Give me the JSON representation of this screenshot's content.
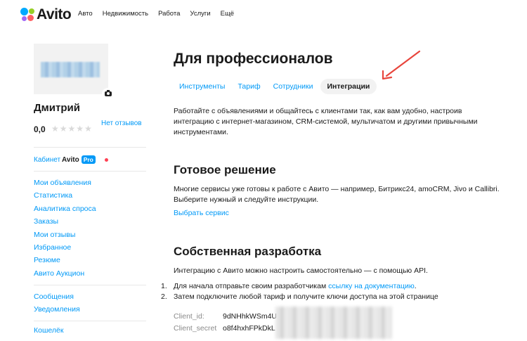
{
  "header": {
    "logo_text": "Avito",
    "nav": [
      "Авто",
      "Недвижимость",
      "Работа",
      "Услуги",
      "Ещё"
    ]
  },
  "sidebar": {
    "user_name": "Дмитрий",
    "rating": "0,0",
    "stars_total": 5,
    "stars_filled": 0,
    "reviews_link": "Нет отзывов",
    "cabinet_label": "Кабинет",
    "cabinet_brand": "Avito",
    "cabinet_badge": "Pro",
    "menu": [
      "Мои объявления",
      "Статистика",
      "Аналитика спроса",
      "Заказы",
      "Мои отзывы",
      "Избранное",
      "Резюме",
      "Авито Аукцион"
    ],
    "menu2": [
      "Сообщения",
      "Уведомления"
    ],
    "menu3": [
      "Кошелёк"
    ]
  },
  "main": {
    "title": "Для профессионалов",
    "tabs": [
      {
        "label": "Инструменты",
        "active": false
      },
      {
        "label": "Тариф",
        "active": false
      },
      {
        "label": "Сотрудники",
        "active": false
      },
      {
        "label": "Интеграции",
        "active": true
      }
    ],
    "intro": "Работайте с объявлениями и общайтесь с клиентами так, как вам удобно, настроив интеграцию с интернет-магазином, CRM-системой, мультичатом и другими привычными инструментами.",
    "ready_title": "Готовое решение",
    "ready_text": "Многие сервисы уже готовы к работе с Авито — например, Битрикс24, amoCRM, Jivo и Callibri. Выберите нужный и следуйте инструкции.",
    "choose_link": "Выбрать сервис",
    "own_title": "Собственная разработка",
    "own_text": "Интеграцию с Авито можно настроить самостоятельно — с помощью API.",
    "steps": [
      {
        "num": "1.",
        "text": "Для начала отправьте своим разработчикам",
        "link": "ссылку на документацию",
        "tail": "."
      },
      {
        "num": "2.",
        "text": "Затем подключите любой тариф и получите ключи доступа на этой странице",
        "link": "",
        "tail": ""
      }
    ],
    "keys": [
      {
        "label": "Client_id:",
        "value": "9dNHhkWSm4U0"
      },
      {
        "label": "Client_secret",
        "value": "o8f4hxhFPkDkL"
      }
    ]
  },
  "colors": {
    "link": "#0099f7",
    "arrow": "#e8453c",
    "badge": "#0099f7"
  }
}
